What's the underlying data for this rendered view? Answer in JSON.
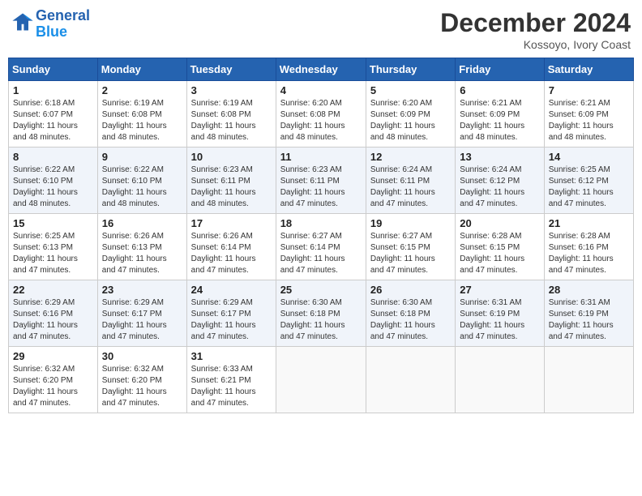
{
  "header": {
    "logo_line1": "General",
    "logo_line2": "Blue",
    "month_title": "December 2024",
    "location": "Kossoyo, Ivory Coast"
  },
  "days_of_week": [
    "Sunday",
    "Monday",
    "Tuesday",
    "Wednesday",
    "Thursday",
    "Friday",
    "Saturday"
  ],
  "weeks": [
    [
      {
        "day": 1,
        "info": "Sunrise: 6:18 AM\nSunset: 6:07 PM\nDaylight: 11 hours\nand 48 minutes."
      },
      {
        "day": 2,
        "info": "Sunrise: 6:19 AM\nSunset: 6:08 PM\nDaylight: 11 hours\nand 48 minutes."
      },
      {
        "day": 3,
        "info": "Sunrise: 6:19 AM\nSunset: 6:08 PM\nDaylight: 11 hours\nand 48 minutes."
      },
      {
        "day": 4,
        "info": "Sunrise: 6:20 AM\nSunset: 6:08 PM\nDaylight: 11 hours\nand 48 minutes."
      },
      {
        "day": 5,
        "info": "Sunrise: 6:20 AM\nSunset: 6:09 PM\nDaylight: 11 hours\nand 48 minutes."
      },
      {
        "day": 6,
        "info": "Sunrise: 6:21 AM\nSunset: 6:09 PM\nDaylight: 11 hours\nand 48 minutes."
      },
      {
        "day": 7,
        "info": "Sunrise: 6:21 AM\nSunset: 6:09 PM\nDaylight: 11 hours\nand 48 minutes."
      }
    ],
    [
      {
        "day": 8,
        "info": "Sunrise: 6:22 AM\nSunset: 6:10 PM\nDaylight: 11 hours\nand 48 minutes."
      },
      {
        "day": 9,
        "info": "Sunrise: 6:22 AM\nSunset: 6:10 PM\nDaylight: 11 hours\nand 48 minutes."
      },
      {
        "day": 10,
        "info": "Sunrise: 6:23 AM\nSunset: 6:11 PM\nDaylight: 11 hours\nand 48 minutes."
      },
      {
        "day": 11,
        "info": "Sunrise: 6:23 AM\nSunset: 6:11 PM\nDaylight: 11 hours\nand 47 minutes."
      },
      {
        "day": 12,
        "info": "Sunrise: 6:24 AM\nSunset: 6:11 PM\nDaylight: 11 hours\nand 47 minutes."
      },
      {
        "day": 13,
        "info": "Sunrise: 6:24 AM\nSunset: 6:12 PM\nDaylight: 11 hours\nand 47 minutes."
      },
      {
        "day": 14,
        "info": "Sunrise: 6:25 AM\nSunset: 6:12 PM\nDaylight: 11 hours\nand 47 minutes."
      }
    ],
    [
      {
        "day": 15,
        "info": "Sunrise: 6:25 AM\nSunset: 6:13 PM\nDaylight: 11 hours\nand 47 minutes."
      },
      {
        "day": 16,
        "info": "Sunrise: 6:26 AM\nSunset: 6:13 PM\nDaylight: 11 hours\nand 47 minutes."
      },
      {
        "day": 17,
        "info": "Sunrise: 6:26 AM\nSunset: 6:14 PM\nDaylight: 11 hours\nand 47 minutes."
      },
      {
        "day": 18,
        "info": "Sunrise: 6:27 AM\nSunset: 6:14 PM\nDaylight: 11 hours\nand 47 minutes."
      },
      {
        "day": 19,
        "info": "Sunrise: 6:27 AM\nSunset: 6:15 PM\nDaylight: 11 hours\nand 47 minutes."
      },
      {
        "day": 20,
        "info": "Sunrise: 6:28 AM\nSunset: 6:15 PM\nDaylight: 11 hours\nand 47 minutes."
      },
      {
        "day": 21,
        "info": "Sunrise: 6:28 AM\nSunset: 6:16 PM\nDaylight: 11 hours\nand 47 minutes."
      }
    ],
    [
      {
        "day": 22,
        "info": "Sunrise: 6:29 AM\nSunset: 6:16 PM\nDaylight: 11 hours\nand 47 minutes."
      },
      {
        "day": 23,
        "info": "Sunrise: 6:29 AM\nSunset: 6:17 PM\nDaylight: 11 hours\nand 47 minutes."
      },
      {
        "day": 24,
        "info": "Sunrise: 6:29 AM\nSunset: 6:17 PM\nDaylight: 11 hours\nand 47 minutes."
      },
      {
        "day": 25,
        "info": "Sunrise: 6:30 AM\nSunset: 6:18 PM\nDaylight: 11 hours\nand 47 minutes."
      },
      {
        "day": 26,
        "info": "Sunrise: 6:30 AM\nSunset: 6:18 PM\nDaylight: 11 hours\nand 47 minutes."
      },
      {
        "day": 27,
        "info": "Sunrise: 6:31 AM\nSunset: 6:19 PM\nDaylight: 11 hours\nand 47 minutes."
      },
      {
        "day": 28,
        "info": "Sunrise: 6:31 AM\nSunset: 6:19 PM\nDaylight: 11 hours\nand 47 minutes."
      }
    ],
    [
      {
        "day": 29,
        "info": "Sunrise: 6:32 AM\nSunset: 6:20 PM\nDaylight: 11 hours\nand 47 minutes."
      },
      {
        "day": 30,
        "info": "Sunrise: 6:32 AM\nSunset: 6:20 PM\nDaylight: 11 hours\nand 47 minutes."
      },
      {
        "day": 31,
        "info": "Sunrise: 6:33 AM\nSunset: 6:21 PM\nDaylight: 11 hours\nand 47 minutes."
      },
      null,
      null,
      null,
      null
    ]
  ]
}
